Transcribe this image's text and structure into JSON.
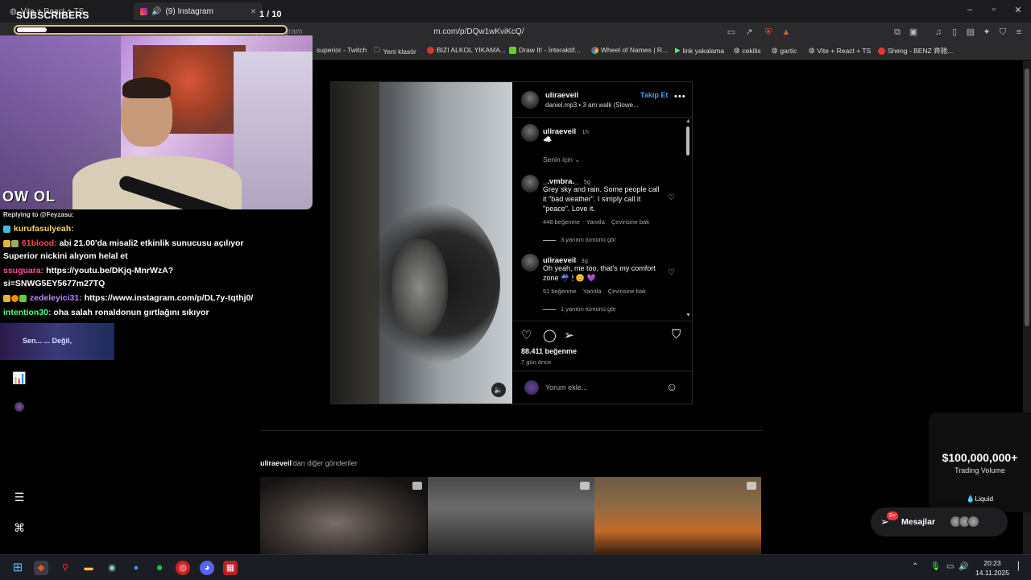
{
  "browser": {
    "tabs": [
      {
        "label": "Vite + React + TS",
        "active": false
      },
      {
        "label": "(9) Instagram",
        "active": true
      }
    ],
    "url_visible": "m.com/p/DQw1wKviKcQ/",
    "url_prefix": "(9) Instagram",
    "bookmarks": [
      "superior - Twitch",
      "Yeni klasör",
      "BIZI ALKOL YIKAMA...",
      "Draw It! - İnteraktif...",
      "Wheel of Names | R...",
      "link yakalama",
      "cekilis",
      "gartic",
      "Vite + React + TS",
      "Sheng - BENZ 奔驰..."
    ]
  },
  "overlay": {
    "title": "SUBSCRIBERS",
    "count": "1 / 10",
    "progress": 0.11,
    "cam_logo": "OW OL",
    "notification": "Sen... ... Değil,"
  },
  "chat": [
    {
      "type": "reply",
      "text": "Replying to @Feyzasu:"
    },
    {
      "user": "kurufasulyeah:",
      "user_color": "#f5d35b",
      "text": ""
    },
    {
      "user": "61blood:",
      "user_color": "#ff4d4d",
      "text": "abi 21.00'da misali2 etkinlik sunucusu açılıyor"
    },
    {
      "user": "",
      "user_color": "#ffffff",
      "text": "Superior nickini alıyom helal et"
    },
    {
      "user": "ssuguara:",
      "user_color": "#ff4da6",
      "text": "https://youtu.be/DKjq-MnrWzA?"
    },
    {
      "user": "",
      "user_color": "#ffffff",
      "text": "si=SNWG5EY5677m27TQ"
    },
    {
      "user": "zedeleyici31:",
      "user_color": "#b98bff",
      "text": "https://www.instagram.com/p/DL7y-tqthj0/"
    },
    {
      "user": "intention30:",
      "user_color": "#5bff7a",
      "text": "oha salah ronaldonun gırtlağını sıkıyor"
    }
  ],
  "post": {
    "username": "uliraeveil",
    "follow_label": "Takip Et",
    "audio": "daniel.mp3 • 3 am walk (Slowe...",
    "caption_user": "uliraeveil",
    "caption_time": "1h",
    "caption_text": "☁️",
    "sort_label": "Senin için",
    "comments": [
      {
        "user": "_.vmbra._",
        "time": "5g",
        "text": "Grey sky and rain. Some people call it \"bad weather\". I simply call it \"peace\". Love it.",
        "likes": "448 beğenme",
        "reply_label": "Yanıtla",
        "translate_label": "Çevirisine bak",
        "view_replies": "3 yanıtın tümünü gör"
      },
      {
        "user": "uliraeveil",
        "time": "3g",
        "text": "Oh yeah, me too, that's my comfort zone ☔ 🕯 😊 💜",
        "likes": "51 beğenme",
        "reply_label": "Yanıtla",
        "translate_label": "Çevirisine bak",
        "view_replies": "1 yanıtın tümünü gör"
      }
    ],
    "like_count": "88.411 beğenme",
    "posted_ago": "7 gün önce",
    "comment_placeholder": "Yorum ekle...",
    "more_from_user": "uliraeveil",
    "more_from_suffix": "'dan diğer gönderiler"
  },
  "ad": {
    "amount": "$100,000,000+",
    "subtitle": "Trading Volume",
    "brand": "💧Liquid"
  },
  "messages": {
    "label": "Mesajlar",
    "badge": "9+"
  },
  "taskbar": {
    "time": "20:23",
    "date": "14.11.2025"
  }
}
